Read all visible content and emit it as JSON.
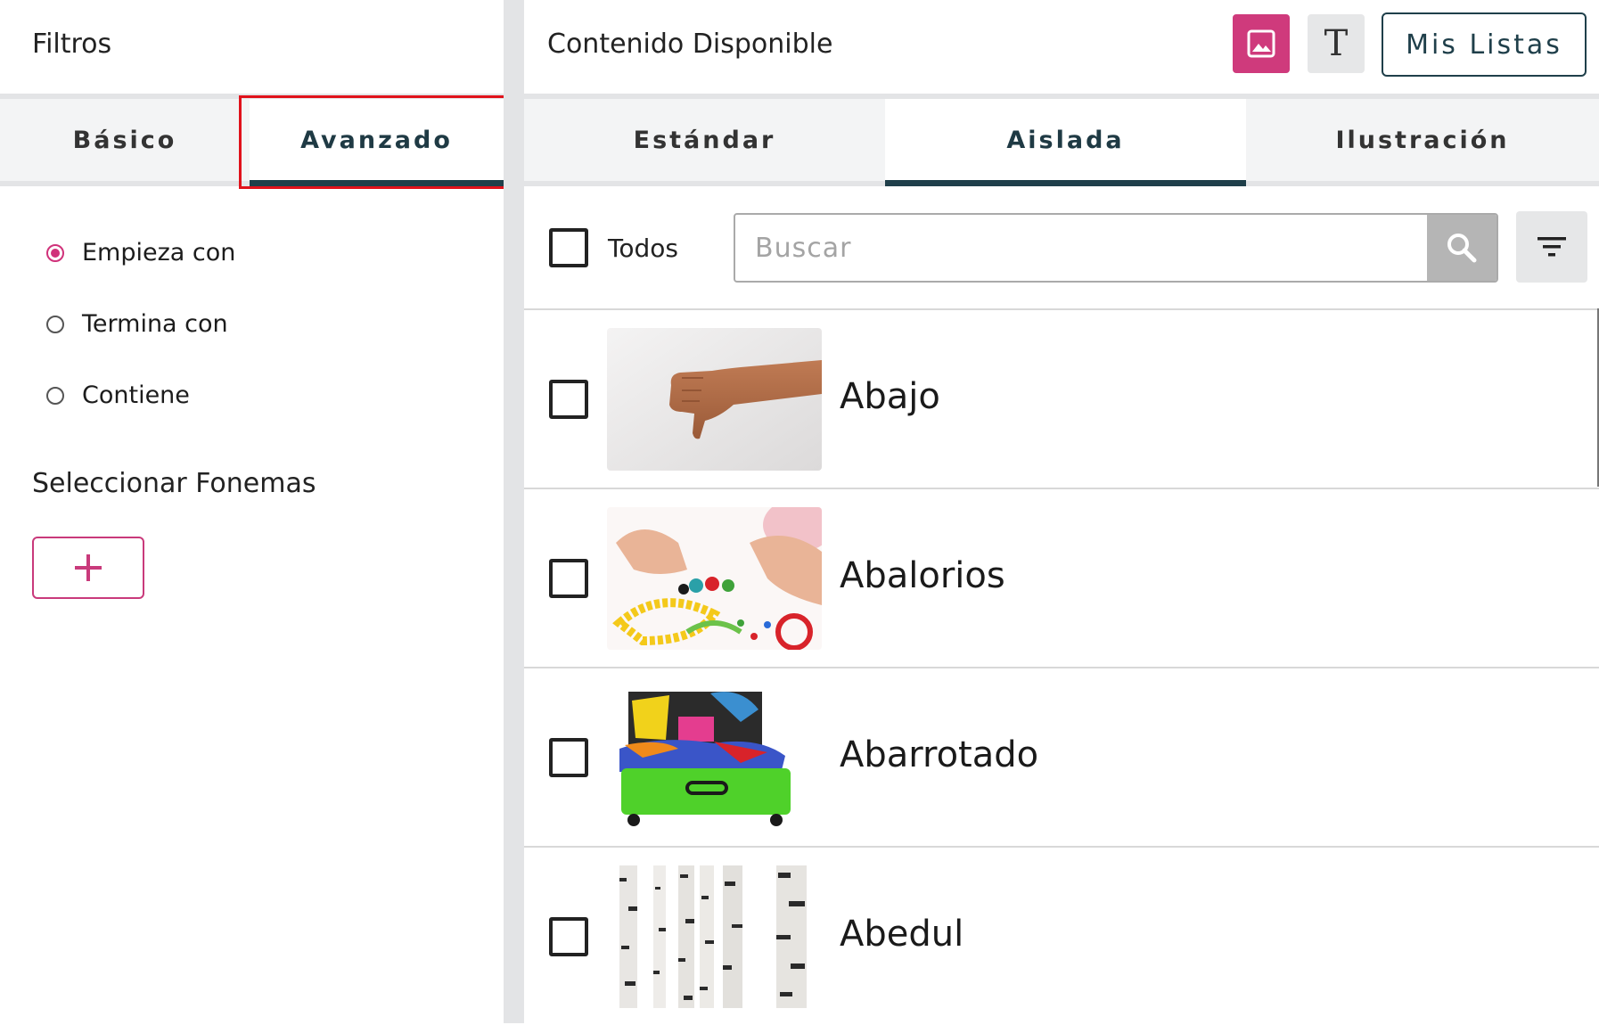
{
  "filters_panel": {
    "title": "Filtros",
    "tabs": [
      {
        "label": "Básico",
        "active": false
      },
      {
        "label": "Avanzado",
        "active": true
      }
    ],
    "match_options": [
      {
        "label": "Empieza con",
        "selected": true
      },
      {
        "label": "Termina con",
        "selected": false
      },
      {
        "label": "Contiene",
        "selected": false
      }
    ],
    "phonemes_label": "Seleccionar Fonemas",
    "add_button_icon": "plus-icon"
  },
  "content_panel": {
    "title": "Contenido Disponible",
    "image_mode_icon": "image-icon",
    "text_mode_glyph": "T",
    "my_lists_label": "Mis Listas",
    "tabs": [
      {
        "label": "Estándar",
        "active": false
      },
      {
        "label": "Aislada",
        "active": true
      },
      {
        "label": "Ilustración",
        "active": false
      }
    ],
    "select_all_label": "Todos",
    "search": {
      "placeholder": "Buscar",
      "value": ""
    },
    "items": [
      {
        "label": "Abajo",
        "image": "thumbs-down-hand"
      },
      {
        "label": "Abalorios",
        "image": "beads"
      },
      {
        "label": "Abarrotado",
        "image": "packed-suitcase"
      },
      {
        "label": "Abedul",
        "image": "birch-trunks"
      }
    ]
  },
  "colors": {
    "accent": "#cf3a7c",
    "primary_dark": "#1f3f4a",
    "highlight_box": "#e0121b",
    "tab_bg": "#f3f4f5",
    "gutter": "#e3e4e6"
  }
}
